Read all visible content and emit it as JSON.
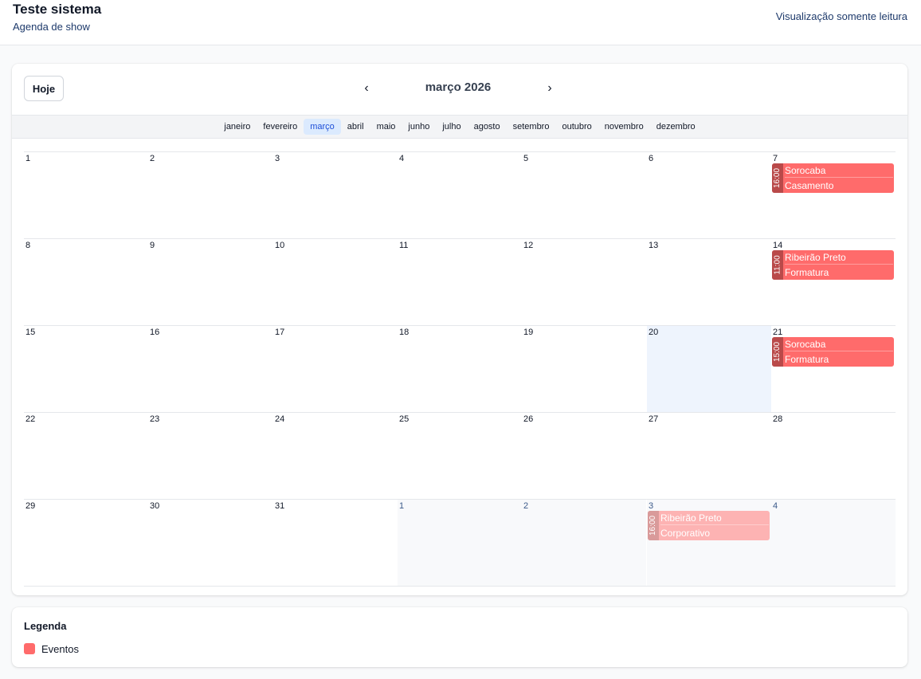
{
  "header": {
    "title": "Teste sistema",
    "subtitle": "Agenda de show",
    "readonly_label": "Visualização somente leitura"
  },
  "toolbar": {
    "today_label": "Hoje",
    "month_title": "março 2026",
    "prev_icon": "chevron-left-icon",
    "next_icon": "chevron-right-icon"
  },
  "months": [
    "janeiro",
    "fevereiro",
    "março",
    "abril",
    "maio",
    "junho",
    "julho",
    "agosto",
    "setembro",
    "outubro",
    "novembro",
    "dezembro"
  ],
  "active_month": "março",
  "weeks": [
    [
      {
        "n": "1"
      },
      {
        "n": "2"
      },
      {
        "n": "3"
      },
      {
        "n": "4"
      },
      {
        "n": "5"
      },
      {
        "n": "6"
      },
      {
        "n": "7",
        "event": {
          "time": "16:00",
          "city": "Sorocaba",
          "type": "Casamento"
        }
      }
    ],
    [
      {
        "n": "8"
      },
      {
        "n": "9"
      },
      {
        "n": "10"
      },
      {
        "n": "11"
      },
      {
        "n": "12"
      },
      {
        "n": "13"
      },
      {
        "n": "14",
        "event": {
          "time": "11:00",
          "city": "Ribeirão Preto",
          "type": "Formatura"
        }
      }
    ],
    [
      {
        "n": "15"
      },
      {
        "n": "16"
      },
      {
        "n": "17"
      },
      {
        "n": "18"
      },
      {
        "n": "19"
      },
      {
        "n": "20",
        "today": true
      },
      {
        "n": "21",
        "event": {
          "time": "15:00",
          "city": "Sorocaba",
          "type": "Formatura"
        }
      }
    ],
    [
      {
        "n": "22"
      },
      {
        "n": "23"
      },
      {
        "n": "24"
      },
      {
        "n": "25"
      },
      {
        "n": "26"
      },
      {
        "n": "27"
      },
      {
        "n": "28"
      }
    ],
    [
      {
        "n": "29"
      },
      {
        "n": "30"
      },
      {
        "n": "31"
      },
      {
        "n": "1",
        "other": true
      },
      {
        "n": "2",
        "other": true
      },
      {
        "n": "3",
        "other": true,
        "event": {
          "time": "16:00",
          "city": "Ribeirão Preto",
          "type": "Corporativo",
          "faded": true
        }
      },
      {
        "n": "4",
        "other": true
      }
    ]
  ],
  "legend": {
    "title": "Legenda",
    "items": [
      {
        "label": "Eventos",
        "color": "#ff6b6b"
      }
    ]
  },
  "colors": {
    "event": "#ff6b6b",
    "event_faded": "#fdb3b3",
    "accent": "#1d4ed8",
    "today": "#eef4fd"
  }
}
